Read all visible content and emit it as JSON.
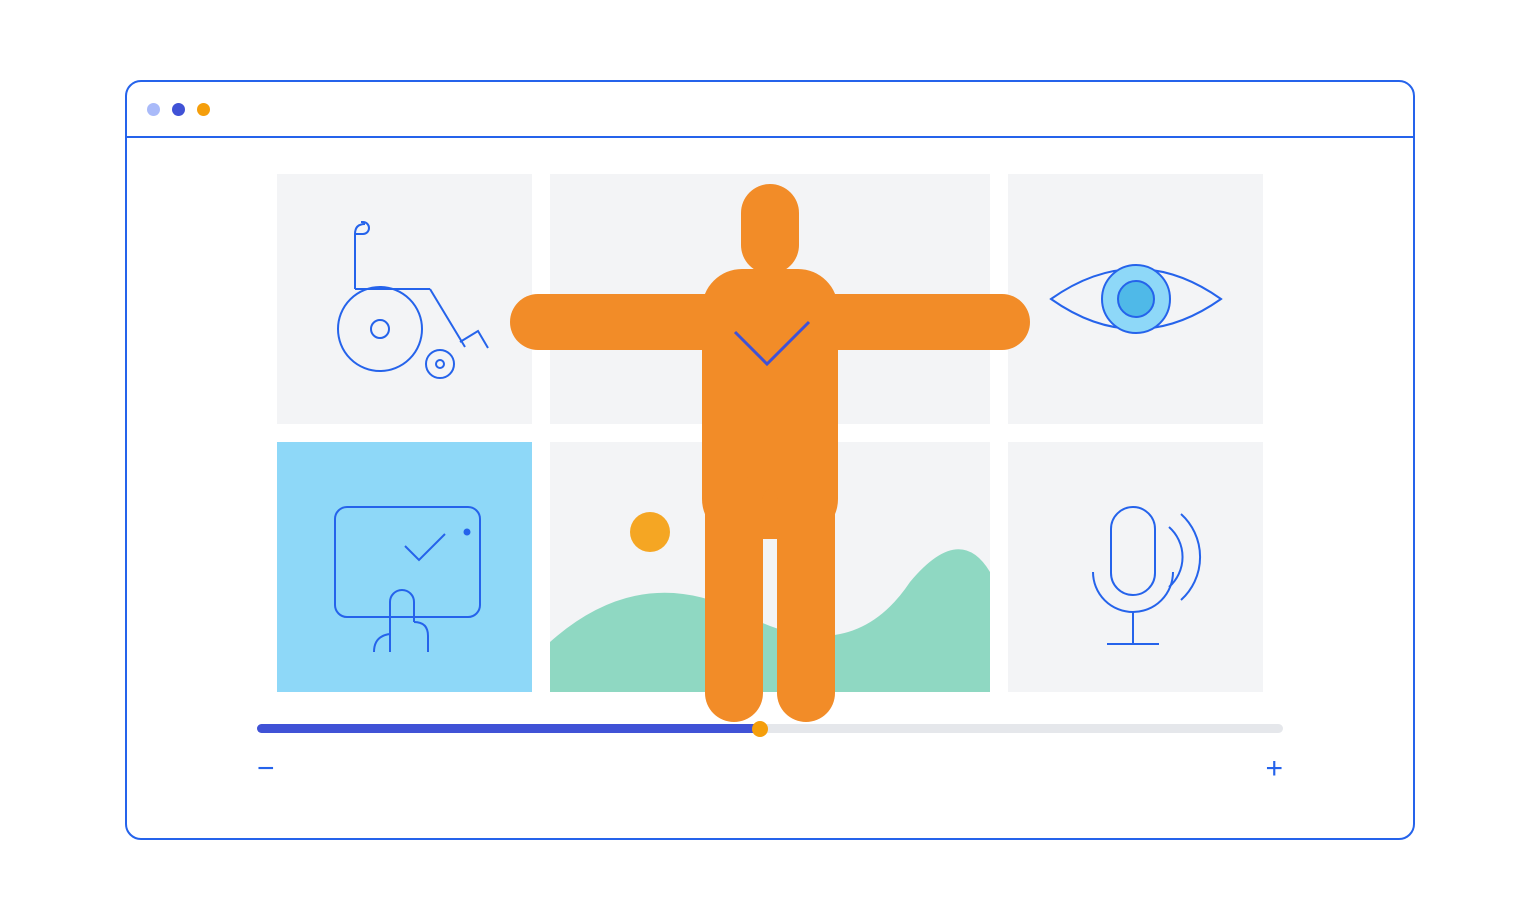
{
  "colors": {
    "window_border": "#2563eb",
    "traffic": [
      "#a9baf9",
      "#4052d6",
      "#f59e0b"
    ],
    "tile_bg": "#f3f4f6",
    "tile_active_bg": "#8ed8f8",
    "icon_stroke": "#2563eb",
    "eye_fill": "#8ed8f8",
    "figure_fill": "#f28c28",
    "landscape_hill": "#8fd8c2",
    "landscape_sun": "#f5a623",
    "check_stroke": "#4052d6",
    "slider_track": "#e5e7eb",
    "slider_fill": "#4052d6",
    "slider_knob": "#f59e0b"
  },
  "tiles": [
    {
      "id": "wheelchair",
      "row": 0,
      "col": 0,
      "icon": "wheelchair-icon",
      "active": false
    },
    {
      "id": "center-top",
      "row": 0,
      "col": 1,
      "icon": null,
      "active": false
    },
    {
      "id": "eye",
      "row": 0,
      "col": 2,
      "icon": "eye-icon",
      "active": false
    },
    {
      "id": "touch",
      "row": 1,
      "col": 0,
      "icon": "touch-check-icon",
      "active": true
    },
    {
      "id": "landscape",
      "row": 1,
      "col": 1,
      "icon": "landscape-icon",
      "active": false
    },
    {
      "id": "microphone",
      "row": 1,
      "col": 2,
      "icon": "microphone-icon",
      "active": false
    }
  ],
  "overlay_figure": {
    "icon": "person-arms-out-icon",
    "check": true
  },
  "slider": {
    "percent": 49
  },
  "zoom": {
    "minus_label": "−",
    "plus_label": "+"
  }
}
